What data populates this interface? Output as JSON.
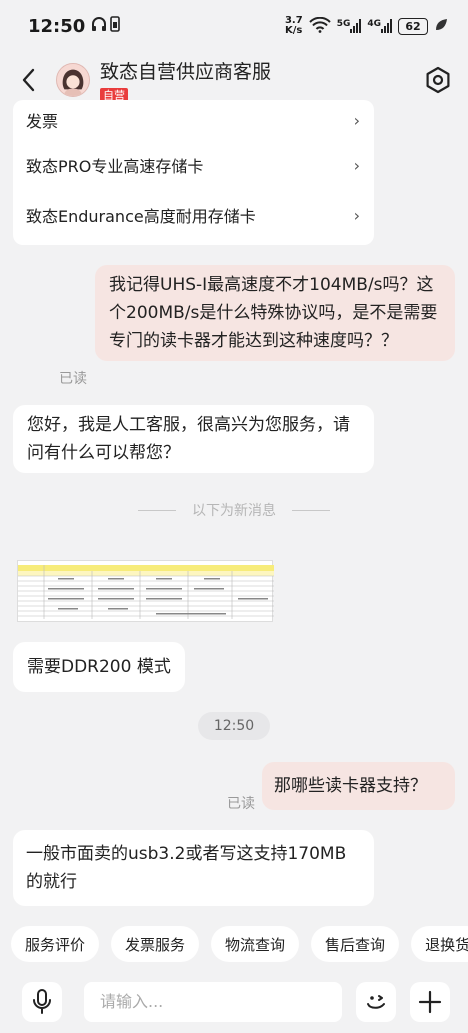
{
  "status": {
    "time": "12:50",
    "net_speed_top": "3.7",
    "net_speed_bottom": "K/s",
    "sim1": "5G",
    "sim2": "4G",
    "battery": "62"
  },
  "header": {
    "title": "致态自营供应商客服",
    "tag": "自营"
  },
  "menu_items": [
    {
      "label": "发票"
    },
    {
      "label": "致态PRO专业高速存储卡"
    },
    {
      "label": "致态Endurance高度耐用存储卡"
    }
  ],
  "messages": {
    "user_q1": "我记得UHS-I最高速度不才104MB/s吗？这个200MB/s是什么特殊协议吗，是不是需要专门的读卡器才能达到这种速度吗？？",
    "read1": "已读",
    "agent_greeting": "您好，我是人工客服，很高兴为您服务，请问有什么可以帮您？",
    "new_messages_divider": "以下为新消息",
    "agent_ddr": "需要DDR200 模式",
    "timestamp": "12:50",
    "user_q2": "那哪些读卡器支持？",
    "read2": "已读",
    "agent_answer": "一般市面卖的usb3.2或者写这支持170MB的就行"
  },
  "quick_actions": [
    "服务评价",
    "发票服务",
    "物流查询",
    "售后查询",
    "退换货"
  ],
  "input": {
    "placeholder": "请输入..."
  },
  "colors": {
    "accent_red": "#e93c3c",
    "my_bubble": "#f6e5e2",
    "background": "#f2f2f3"
  }
}
